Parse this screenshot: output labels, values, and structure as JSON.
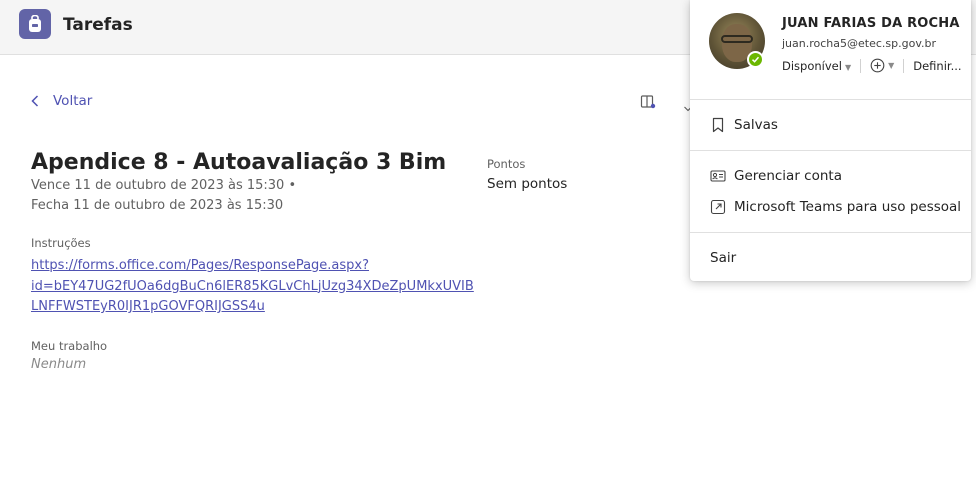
{
  "app": {
    "title": "Tarefas",
    "icon": "backpack-icon",
    "accent": "#6264a7"
  },
  "nav": {
    "back_label": "Voltar"
  },
  "assignment": {
    "title": "Apendice 8 - Autoavaliação 3 Bim",
    "due": "Vence 11 de outubro de 2023 às 15:30 •",
    "closes": "Fecha 11 de outubro de 2023 às 15:30",
    "points_label": "Pontos",
    "points_value": "Sem pontos",
    "instructions_label": "Instruções",
    "link_lines": [
      "https://forms.office.com/Pages/ResponsePage.aspx?",
      "id=bEY47UG2fUOa6dgBuCn6lER85KGLvChLjUzg34XDeZpUMkxUVIB",
      "LNFFWSTEyR0IJR1pGOVFQRIJGSS4u"
    ],
    "my_work_label": "Meu trabalho",
    "my_work_value": "Nenhum"
  },
  "profile": {
    "name": "JUAN FARIAS DA ROCHA",
    "email": "juan.rocha5@etec.sp.gov.br",
    "status": "Disponível",
    "status_color": "#6bb700",
    "set_label": "Definir...",
    "menu": {
      "saved": "Salvas",
      "manage": "Gerenciar conta",
      "personal": "Microsoft Teams para uso pessoal",
      "signout": "Sair"
    }
  }
}
